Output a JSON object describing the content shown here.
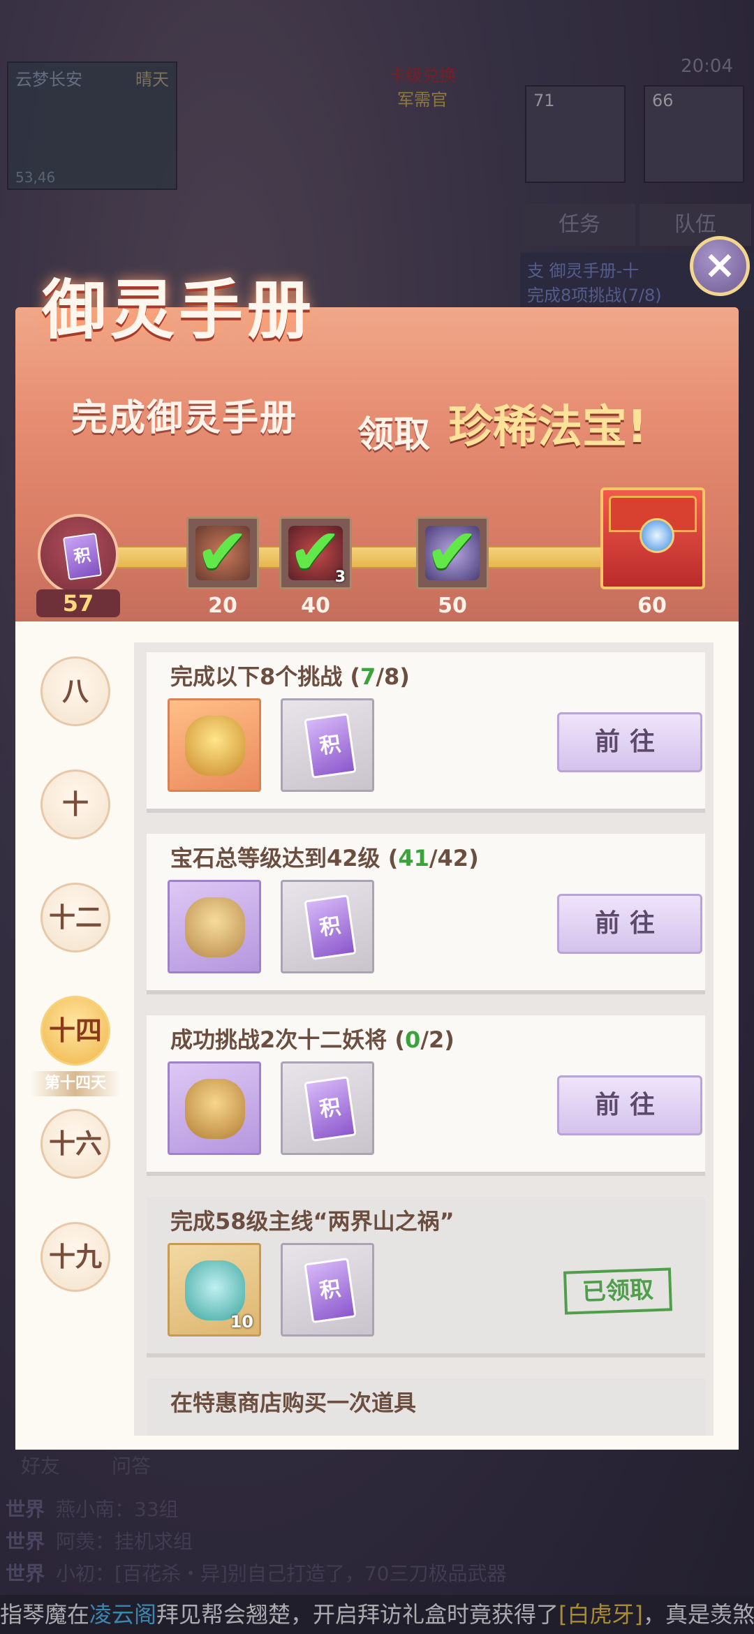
{
  "scene": {
    "map_name": "云梦长安",
    "weather": "晴天",
    "coords": "53,46",
    "npc_line1": "卡级兑换",
    "npc_line2": "军需官",
    "clock": "20:04",
    "party": [
      {
        "level": "71"
      },
      {
        "level": "66"
      }
    ],
    "hud_tabs": [
      "任务",
      "队伍"
    ],
    "hud_quest": "支 御灵手册-十",
    "hud_quest_sub": "完成8项挑战(7/8)",
    "friends": "好友",
    "qa": "问答",
    "chat": [
      {
        "channel": "世界",
        "text": "燕小南：33组"
      },
      {
        "channel": "世界",
        "text": "阿羡：挂机求组"
      },
      {
        "channel": "世界",
        "text": "小初：[百花杀・异]别自己打造了，70三刀极品武器"
      }
    ],
    "ticker": {
      "p1": "指琴魔在",
      "place": "凌云阁",
      "p2": "拜见帮会翘楚，开启拜访礼盒时竟获得了",
      "item": "[白虎牙]",
      "p3": "，真是羡煞旁人"
    }
  },
  "panel": {
    "title": "御灵手册",
    "slogan_left": "完成御灵手册",
    "slogan_mid": "领取",
    "slogan_right": "珍稀法宝!",
    "close_icon": "×",
    "points_card_glyph": "积",
    "points": "57",
    "milestones": [
      {
        "value": "20",
        "claimed": true
      },
      {
        "value": "40",
        "claimed": true,
        "qty": "3"
      },
      {
        "value": "50",
        "claimed": true
      },
      {
        "value": "60",
        "claimed": false
      }
    ]
  },
  "days": [
    {
      "label": "八"
    },
    {
      "label": "十"
    },
    {
      "label": "十二"
    },
    {
      "label": "十四",
      "active": true,
      "sub": "第十四天"
    },
    {
      "label": "十六"
    },
    {
      "label": "十九"
    }
  ],
  "tasks": [
    {
      "title": "完成以下8个挑战",
      "done": "7",
      "total": "8",
      "button": "前往",
      "reward1": "gold-ingot-chest-icon",
      "card_glyph": "积"
    },
    {
      "title": "宝石总等级达到42级",
      "done": "41",
      "total": "42",
      "button": "前往",
      "reward1": "coin-bag-icon",
      "card_glyph": "积"
    },
    {
      "title": "成功挑战2次十二妖将",
      "done": "0",
      "total": "2",
      "button": "前往",
      "reward1": "gold-bag-icon",
      "card_glyph": "积"
    },
    {
      "title": "完成58级主线“两界山之祸”",
      "status": "已领取",
      "reward1": "potion-bottle-icon",
      "reward1_qty": "10",
      "card_glyph": "积"
    },
    {
      "title": "在特惠商店购买一次道具"
    }
  ],
  "colors": {
    "banner": "#e68d72",
    "progress": "#f4d27a",
    "done_green": "#3aa33a",
    "button_purple": "#d4c2ec"
  }
}
